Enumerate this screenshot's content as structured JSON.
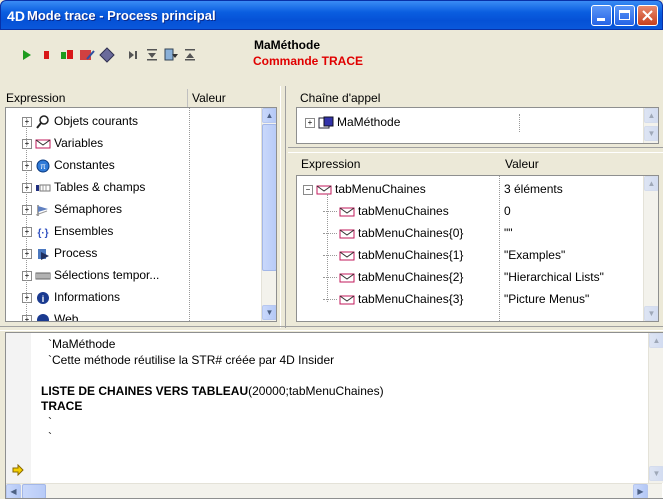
{
  "window": {
    "title": "Mode trace - Process principal",
    "icon": "4d-logo-icon"
  },
  "toolbar": {
    "tools": [
      "play-icon",
      "stop-icon",
      "abort-icon",
      "edit-icon",
      "diamond-icon",
      "step-icon",
      "step-into-icon",
      "step-over-icon",
      "step-out-icon"
    ],
    "method_name": "MaMéthode",
    "command_label": "Commande TRACE"
  },
  "expression_pane": {
    "col_expression": "Expression",
    "col_value": "Valeur",
    "items": [
      {
        "label": "Objets courants",
        "icon": "magnifier-icon"
      },
      {
        "label": "Variables",
        "icon": "variable-icon"
      },
      {
        "label": "Constantes",
        "icon": "pi-icon"
      },
      {
        "label": "Tables & champs",
        "icon": "table-icon"
      },
      {
        "label": "Sémaphores",
        "icon": "flag-icon"
      },
      {
        "label": "Ensembles",
        "icon": "set-icon"
      },
      {
        "label": "Process",
        "icon": "process-icon"
      },
      {
        "label": "Sélections tempor...",
        "icon": "selection-icon"
      },
      {
        "label": "Informations",
        "icon": "info-icon"
      },
      {
        "label": "Web",
        "icon": "web-icon"
      }
    ]
  },
  "call_chain": {
    "header": "Chaîne d'appel",
    "items": [
      {
        "label": "MaMéthode",
        "icon": "method-icon"
      }
    ]
  },
  "detail_pane": {
    "col_expression": "Expression",
    "col_value": "Valeur",
    "rows": [
      {
        "expr": "tabMenuChaines",
        "value": "3 éléments"
      },
      {
        "expr": "tabMenuChaines",
        "value": "0"
      },
      {
        "expr": "tabMenuChaines{0}",
        "value": "\"\""
      },
      {
        "expr": "tabMenuChaines{1}",
        "value": "\"Examples\""
      },
      {
        "expr": "tabMenuChaines{2}",
        "value": "\"Hierarchical Lists\""
      },
      {
        "expr": "tabMenuChaines{3}",
        "value": "\"Picture Menus\""
      }
    ]
  },
  "source": {
    "lines": [
      {
        "text": "`MaMéthode",
        "bold": false
      },
      {
        "text": "`Cette méthode réutilise la STR# créée par 4D Insider",
        "bold": false
      },
      {
        "text": "",
        "bold": false
      },
      {
        "text_bold": "LISTE DE CHAINES VERS TABLEAU",
        "text_rest": "(20000;tabMenuChaines)",
        "bold": true
      },
      {
        "text": "TRACE",
        "bold": true
      },
      {
        "text": "`",
        "bold": false
      },
      {
        "text": "`",
        "bold": false
      }
    ]
  }
}
